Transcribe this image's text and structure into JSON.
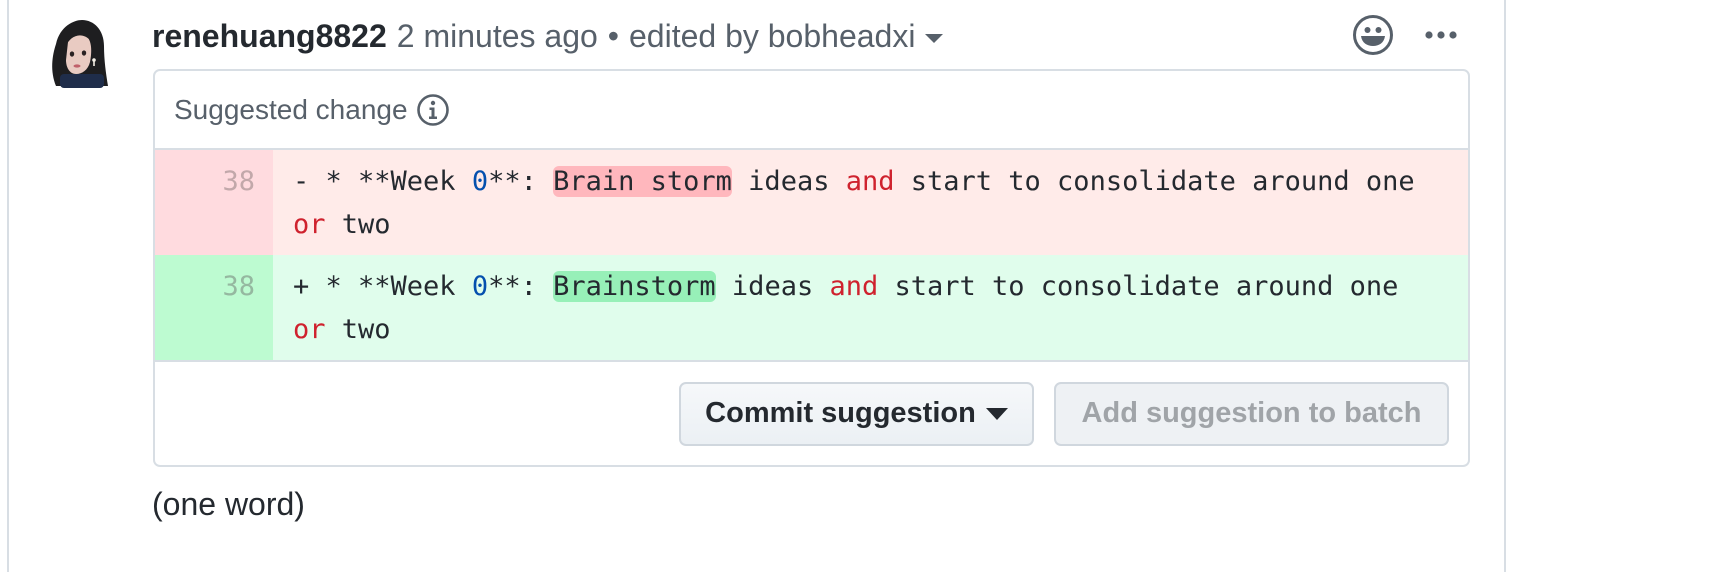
{
  "comment": {
    "author": "renehuang8822",
    "timestamp": "2 minutes ago",
    "separator": "•",
    "edited_by": "edited by bobheadxi",
    "body": "(one word)"
  },
  "icons": {
    "avatar": "user-avatar",
    "reaction": "smiley-icon",
    "more": "kebab-horizontal-icon",
    "info": "info-icon",
    "edited_caret": "triangle-down-icon",
    "commit_caret": "triangle-down-icon"
  },
  "suggestion": {
    "title": "Suggested change",
    "rows": [
      {
        "type": "deletion",
        "line_number": "38",
        "prefix": "- * **Week ",
        "number_token": "0",
        "after_number": "**: ",
        "changed": "Brain storm",
        "mid1": " ideas ",
        "kw1": "and",
        "mid2": " start to consolidate around one ",
        "kw2": "or",
        "tail": " two"
      },
      {
        "type": "addition",
        "line_number": "38",
        "prefix": "+ * **Week ",
        "number_token": "0",
        "after_number": "**: ",
        "changed": "Brainstorm",
        "mid1": " ideas ",
        "kw1": "and",
        "mid2": " start to consolidate around one ",
        "kw2": "or",
        "tail": " two"
      }
    ],
    "commit_button": "Commit suggestion",
    "batch_button": "Add suggestion to batch",
    "batch_disabled": true
  },
  "colors": {
    "deletion_bg": "#ffebe9",
    "addition_bg": "#e6ffec",
    "deletion_highlight": "#ffb7bd",
    "addition_highlight": "#97f0b8",
    "keyword": "#cf222e",
    "number": "#0550ae"
  }
}
